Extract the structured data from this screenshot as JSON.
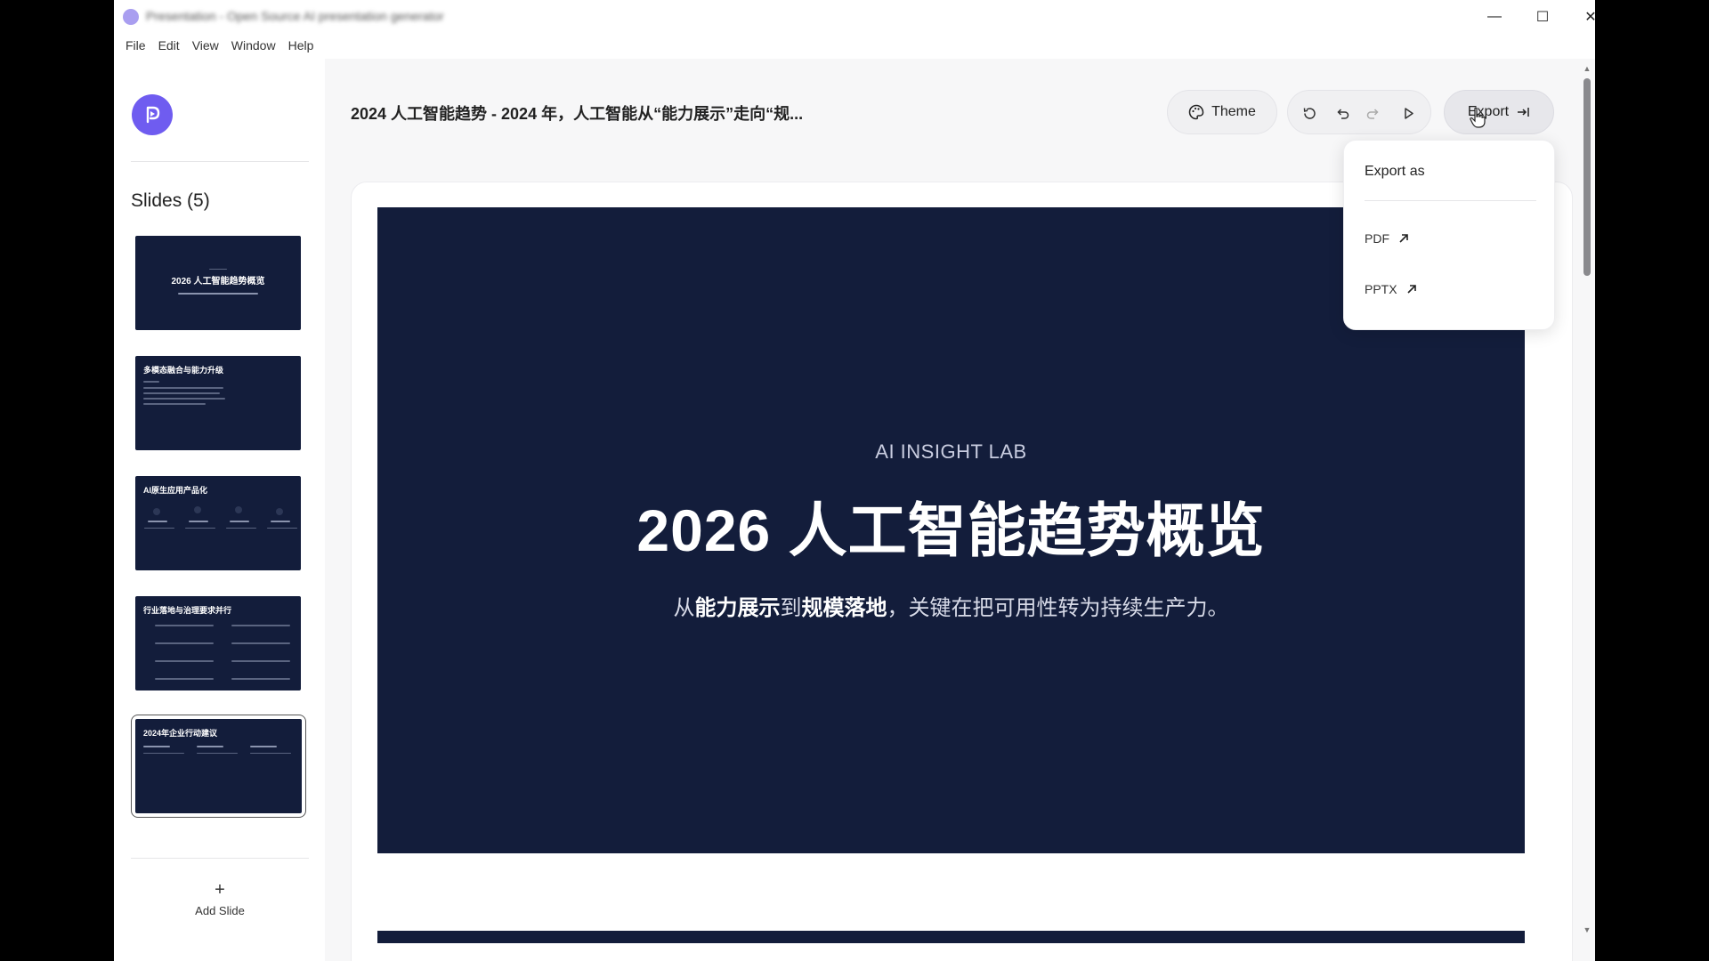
{
  "window": {
    "title": "Presentation - Open Source AI presentation generator",
    "min_glyph": "—",
    "max_glyph": "☐",
    "close_glyph": "✕"
  },
  "menu": [
    "File",
    "Edit",
    "View",
    "Window",
    "Help"
  ],
  "sidebar": {
    "slides_heading": "Slides (5)",
    "thumbnails": [
      {
        "title": "2026 人工智能趋势概览"
      },
      {
        "title": "多模态融合与能力升级"
      },
      {
        "title": "AI原生应用产品化"
      },
      {
        "title": "行业落地与治理要求并行"
      },
      {
        "title": "2024年企业行动建议"
      }
    ],
    "add_slide_label": "Add Slide",
    "add_slide_glyph": "+"
  },
  "header": {
    "doc_title": "2024 人工智能趋势 - 2024 年，人工智能从“能力展示”走向“规...",
    "theme_label": "Theme",
    "export_label": "Export"
  },
  "slide": {
    "eyebrow": "AI INSIGHT LAB",
    "title": "2026 人工智能趋势概览",
    "subtitle_parts": [
      "从",
      "能力展示",
      "到",
      "规模落地",
      "，关键在把可用性转为持续生产力。"
    ]
  },
  "export_menu": {
    "heading": "Export as",
    "options": [
      "PDF",
      "PPTX"
    ]
  },
  "colors": {
    "accent": "#6f5cf0",
    "slide_bg": "#131d3b"
  }
}
